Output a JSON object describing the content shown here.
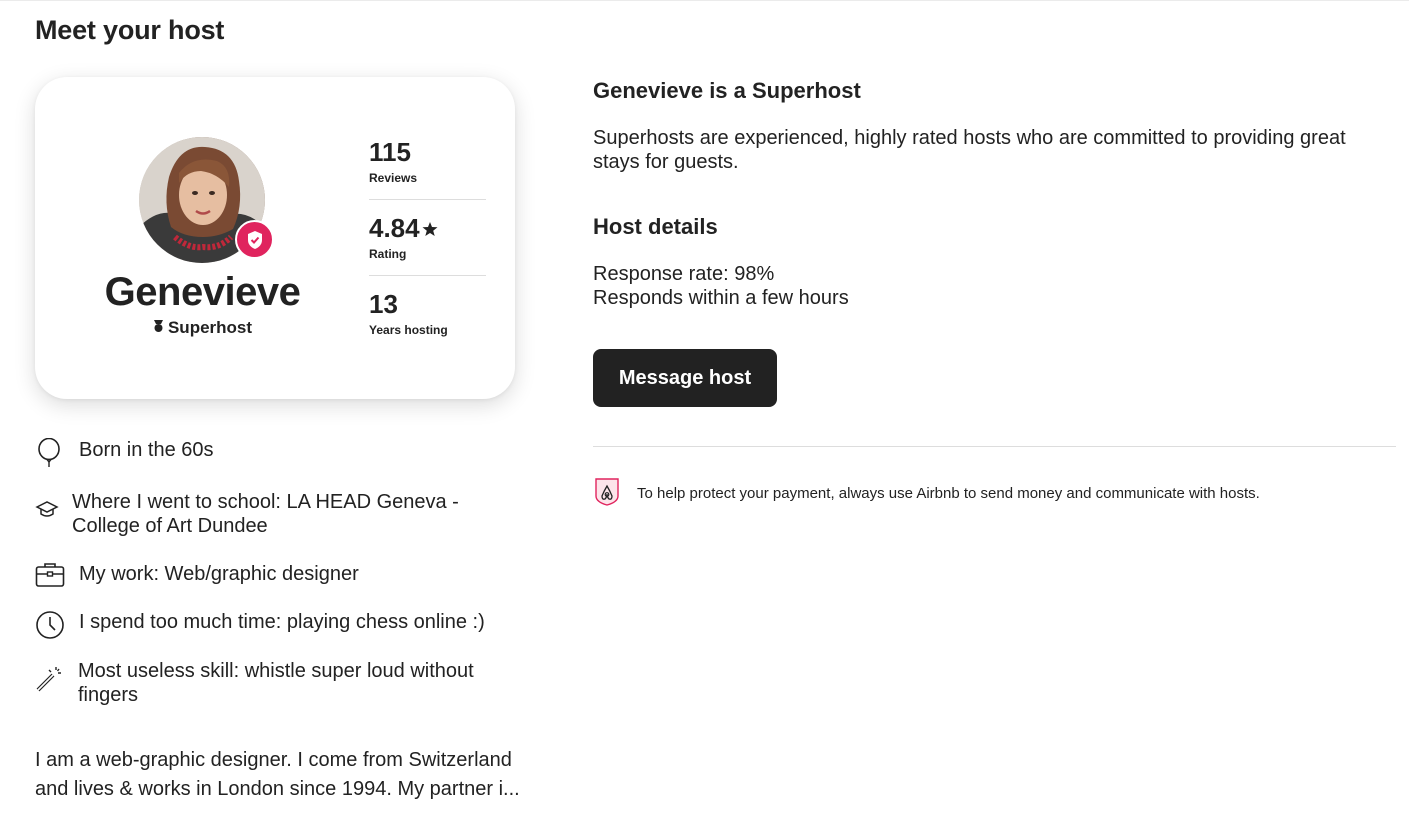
{
  "section_title": "Meet your host",
  "host": {
    "name": "Genevieve",
    "badge": "Superhost",
    "stats": [
      {
        "value": "115",
        "label": "Reviews"
      },
      {
        "value": "4.84",
        "label": "Rating"
      },
      {
        "value": "13",
        "label": "Years hosting"
      }
    ]
  },
  "facts": [
    {
      "icon": "balloon-icon",
      "text": "Born in the 60s"
    },
    {
      "icon": "graduation-cap-icon",
      "text": "Where I went to school: LA HEAD Geneva - College of Art Dundee"
    },
    {
      "icon": "briefcase-icon",
      "text": "My work: Web/graphic designer"
    },
    {
      "icon": "clock-icon",
      "text": "I spend too much time: playing chess online :)"
    },
    {
      "icon": "magic-wand-icon",
      "text": "Most useless skill: whistle super loud without fingers"
    }
  ],
  "about": "I am a web-graphic designer. I come from Switzerland and lives & works in London since 1994. My partner i...",
  "superhost_info": {
    "title": "Genevieve is a Superhost",
    "description": "Superhosts are experienced, highly rated hosts who are committed to providing great stays for guests."
  },
  "host_details": {
    "title": "Host details",
    "response_rate": "Response rate: 98%",
    "response_time": "Responds within a few hours"
  },
  "message_button": "Message host",
  "protect_notice": "To help protect your payment, always use Airbnb to send money and communicate with hosts.",
  "colors": {
    "accent": "#e0245e",
    "text": "#222222",
    "button_bg": "#222222",
    "divider": "#dddddd"
  }
}
